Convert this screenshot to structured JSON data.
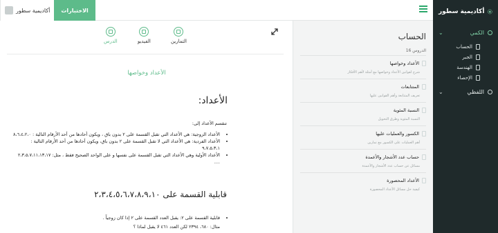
{
  "brand": {
    "name": "أكاديمية سطور"
  },
  "sidebar": {
    "sections": [
      {
        "label": "الكمي",
        "items": [
          "الحساب",
          "الجبر",
          "الهندسة",
          "الإحصاء"
        ]
      },
      {
        "label": "اللفظي"
      }
    ]
  },
  "header": {
    "tests_label": "الاختبارات",
    "user_name": "أكاديمية سطور"
  },
  "lesson_panel": {
    "title": "الحساب",
    "lessons_count": "الدروس 16",
    "lessons": [
      {
        "title": "الأعداد وخواصها",
        "desc": "شرح لقوانين الأعداد وخواصها مع أمثلة لأهم الأفكار"
      },
      {
        "title": "المتتابعات",
        "desc": "تعريف المتتابعة وأهم القوانين عليها"
      },
      {
        "title": "النسبة المئوية",
        "desc": "النسبة المئوية وطرق التحويل"
      },
      {
        "title": "الكسور والعمليات عليها",
        "desc": "أهم العمليات على الكسور مع تمارين"
      },
      {
        "title": "حساب عدد الأشجار والأعمدة",
        "desc": "مسائل عن حساب عدد الأشجار والأعمدة"
      },
      {
        "title": "الأعداد المحصورة",
        "desc": "كيفية حل مسائل الأعداد المحصورة"
      }
    ]
  },
  "content": {
    "tabs": [
      {
        "label": "الدرس",
        "active": true
      },
      {
        "label": "الفيديو"
      },
      {
        "label": "التمارين"
      }
    ],
    "lesson_title": "الأعداد وخواصها",
    "h1": "الأعداد:",
    "intro": "تنقسم الأعداد إلى:",
    "bullets": [
      "الأعداد الزوجية: هي الأعداد التي تقبل القسمة على ٢ بدون باق ، ويكون أحادها من أحد الأرقام التالية : ٨،٦،٤،٢،٠",
      "الأعداد الفردية: هي الأعداد التي لا تقبل القسمة على ٢ بدون باق، ويكون أحادها من أحد الأرقام التالية : ٩،٧،٥،٣،١",
      "الأعداد الأولية وهي الأعداد التي تقبل القسمة على نفسها و على الواحد الصحيح فقط ، مثل: ٢،٣،٥،٧،١١،١٣،١٧ .... "
    ],
    "h2": "قابلية القسمة على ٢،٣،٤،٥،٦،٧،٨،٩،١٠",
    "bullets2": [
      "قابلية القسمة على ٢: يقبل العدد القسمة على ٢ إذا كان زوجياً ."
    ],
    "example": "مثال: ٦٨٠، ٢٣٩٤ لكن العدد ٤٦١ لا يقبل لماذا ؟"
  },
  "colors": {
    "accent": "#5dbb8a",
    "sidebar_bg": "#1f2a2b"
  },
  "icons": [
    "logo-icon",
    "menu-icon",
    "expand-icon",
    "document-icon",
    "chevron-down-icon"
  ]
}
